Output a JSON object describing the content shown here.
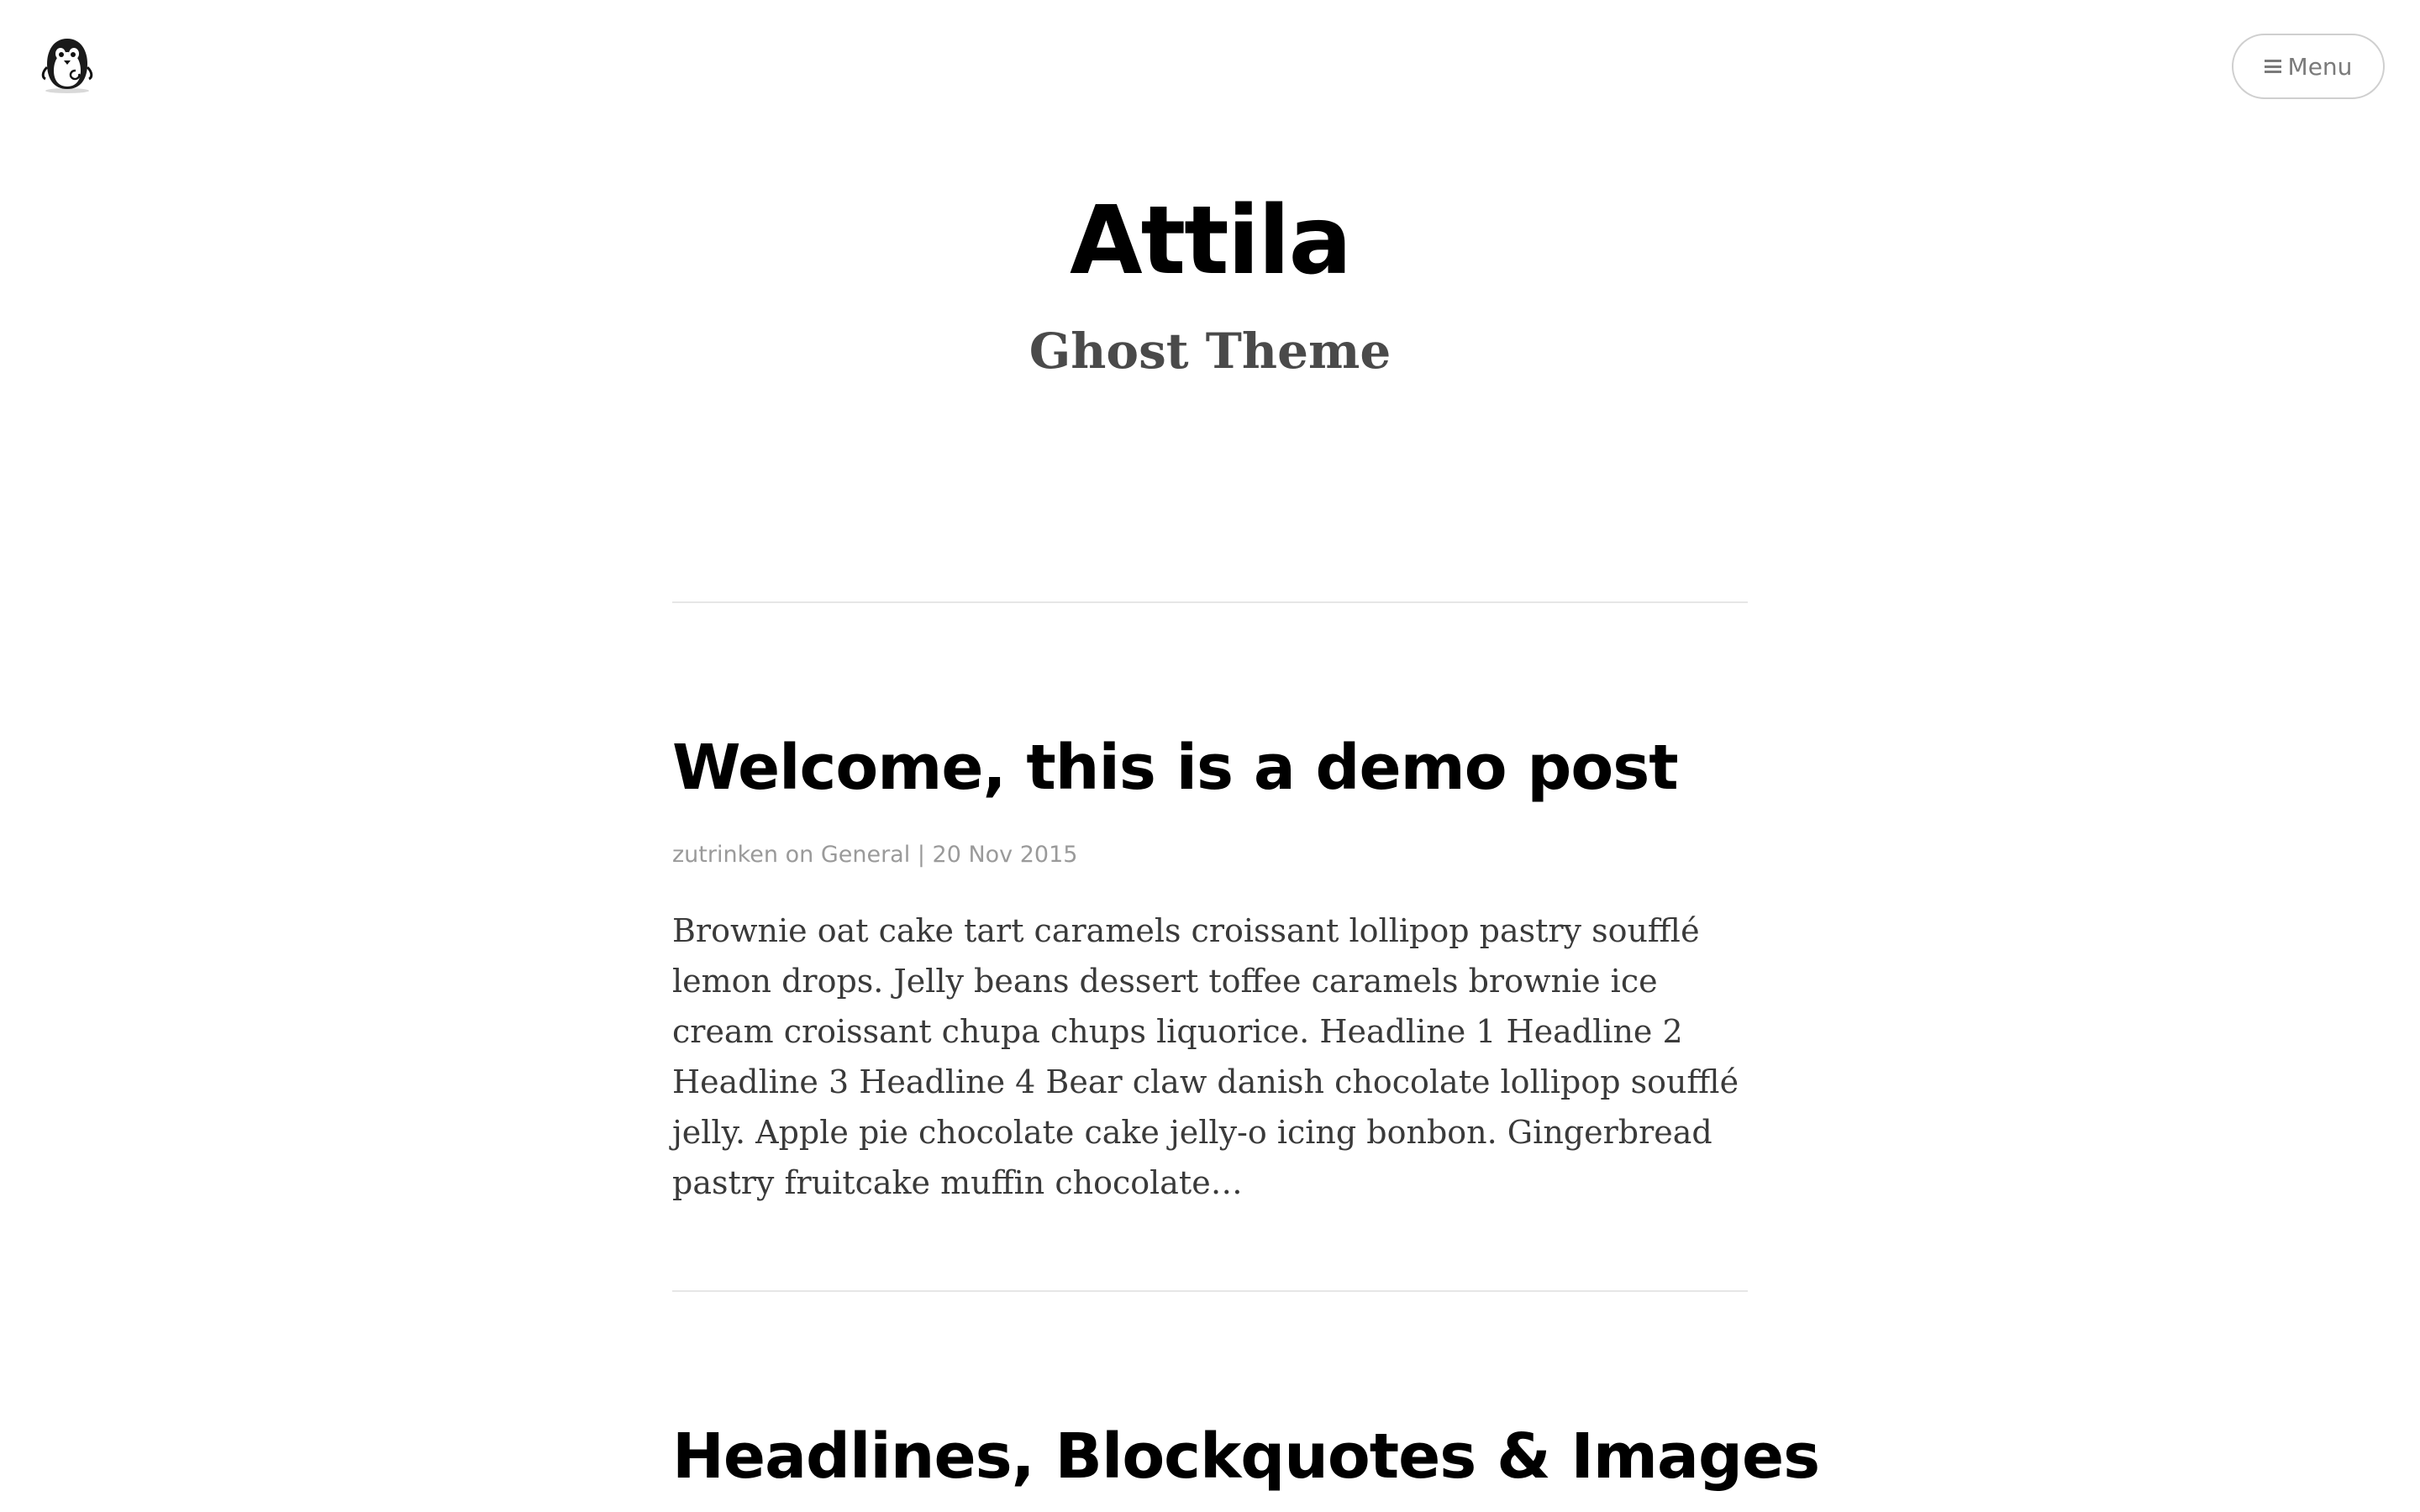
{
  "header": {
    "logo_icon": "penguin-logo-icon",
    "menu_icon": "hamburger-icon",
    "menu_label": "Menu"
  },
  "site": {
    "title": "Attila",
    "subtitle": "Ghost Theme"
  },
  "posts": [
    {
      "title": "Welcome, this is a demo post",
      "author": "zutrinken",
      "on": "on",
      "category": "General",
      "separator": "|",
      "date": "20 Nov 2015",
      "excerpt": "Brownie oat cake tart caramels croissant lollipop pastry soufflé lemon drops. Jelly beans dessert toffee caramels brownie ice cream croissant chupa chups liquorice. Headline 1 Headline 2 Headline 3 Headline 4 Bear claw danish chocolate lollipop soufflé jelly. Apple pie chocolate cake jelly-o icing bonbon. Gingerbread pastry fruitcake muffin chocolate…"
    },
    {
      "title": "Headlines, Blockquotes & Images"
    }
  ],
  "colors": {
    "background": "#ffffff",
    "title": "#000000",
    "subtitle": "#4a4a4a",
    "meta": "#9a9a9a",
    "excerpt": "#3a3a3a",
    "divider": "#e6e6e6",
    "menu_border": "#cfcfcf"
  }
}
